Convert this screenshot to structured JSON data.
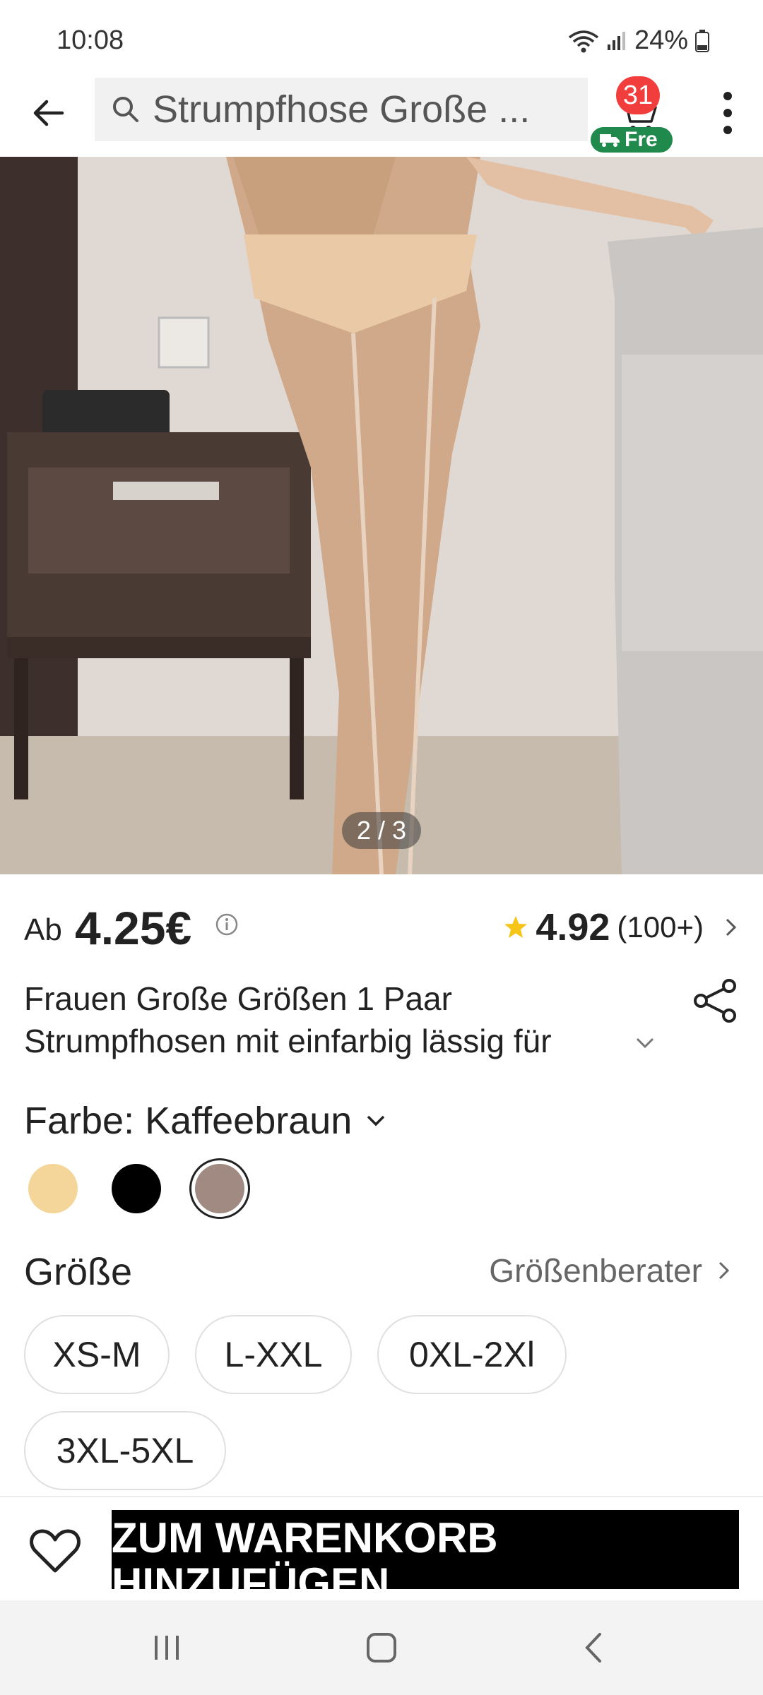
{
  "status": {
    "time": "10:08",
    "battery": "24%"
  },
  "header": {
    "search_text": "Strumpfhose Große ...",
    "cart_count": "31",
    "free_label": "Fre"
  },
  "gallery": {
    "counter": "2 / 3"
  },
  "product": {
    "price_prefix": "Ab",
    "price": "4.25€",
    "rating": "4.92",
    "rating_count": "(100+)",
    "title_line1": "Frauen Große Größen 1 Paar",
    "title_line2": "Strumpfhosen mit einfarbig lässig für"
  },
  "color": {
    "label": "Farbe: Kaffeebraun",
    "swatches": [
      {
        "name": "beige",
        "hex": "#f5d69a"
      },
      {
        "name": "black",
        "hex": "#000000"
      },
      {
        "name": "kaffeebraun",
        "hex": "#a08a82",
        "selected": true
      }
    ]
  },
  "size": {
    "label": "Größe",
    "guide_label": "Größenberater",
    "options": [
      "XS-M",
      "L-XXL",
      "0XL-2Xl",
      "3XL-5XL"
    ]
  },
  "actions": {
    "add_to_cart": "ZUM WARENKORB HINZUFÜGEN"
  },
  "colors": {
    "badge_red": "#f23d3d",
    "free_green": "#1f8a4c",
    "star_yellow": "#f5c518",
    "button_black": "#000000"
  }
}
